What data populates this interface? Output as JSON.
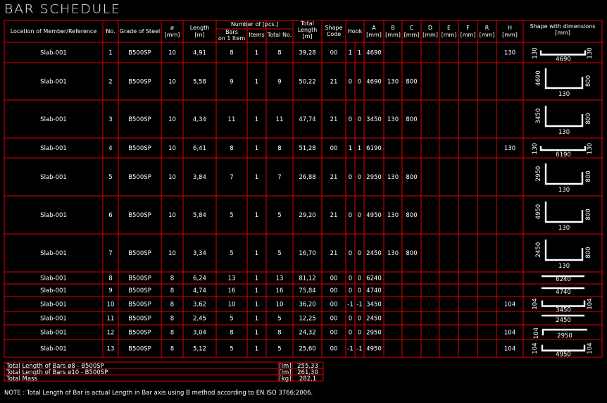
{
  "title": "BAR SCHEDULE",
  "headers": {
    "location": "Location of Member/Reference",
    "no": "No.",
    "grade": "Grade of Steel",
    "phi": "ø",
    "phi_unit": "[mm]",
    "length": "Length",
    "length_unit": "[m]",
    "number_of": "Number of [pcs.]",
    "bars_on": "Bars",
    "bars_on2": "on 1 Item",
    "items": "Items",
    "total_no": "Total No.",
    "total_length": "Total",
    "total_length2": "Length",
    "total_length_unit": "[m]",
    "shape": "Shape",
    "shape2": "Code",
    "hook": "Hook",
    "A": "A",
    "B": "B",
    "C": "C",
    "D": "D",
    "E": "E",
    "F": "F",
    "R": "R",
    "H": "H",
    "mm": "[mm]",
    "shape_dims": "Shape with dimensions",
    "shape_dims_unit": "[mm]"
  },
  "rows": [
    {
      "loc": "Slab-001",
      "no": "1",
      "grade": "B500SP",
      "phi": "10",
      "len": "4,91",
      "bars": "8",
      "items": "1",
      "total": "8",
      "tlen": "39,28",
      "code": "00",
      "h1": "1",
      "h2": "1",
      "A": "4690",
      "B": "",
      "C": "",
      "H": "130",
      "shape": "UL",
      "dims": [
        "130",
        "4690",
        "130"
      ]
    },
    {
      "loc": "Slab-001",
      "no": "2",
      "grade": "B500SP",
      "phi": "10",
      "len": "5,58",
      "bars": "9",
      "items": "1",
      "total": "9",
      "tlen": "50,22",
      "code": "21",
      "h1": "0",
      "h2": "0",
      "A": "4690",
      "B": "130",
      "C": "800",
      "H": "",
      "shape": "U",
      "dims": [
        "4690",
        "130",
        "800"
      ]
    },
    {
      "loc": "Slab-001",
      "no": "3",
      "grade": "B500SP",
      "phi": "10",
      "len": "4,34",
      "bars": "11",
      "items": "1",
      "total": "11",
      "tlen": "47,74",
      "code": "21",
      "h1": "0",
      "h2": "0",
      "A": "3450",
      "B": "130",
      "C": "800",
      "H": "",
      "shape": "U",
      "dims": [
        "3450",
        "130",
        "800"
      ]
    },
    {
      "loc": "Slab-001",
      "no": "4",
      "grade": "B500SP",
      "phi": "10",
      "len": "6,41",
      "bars": "8",
      "items": "1",
      "total": "8",
      "tlen": "51,28",
      "code": "00",
      "h1": "1",
      "h2": "1",
      "A": "6190",
      "B": "",
      "C": "",
      "H": "130",
      "shape": "UL",
      "dims": [
        "130",
        "6190",
        "130"
      ]
    },
    {
      "loc": "Slab-001",
      "no": "5",
      "grade": "B500SP",
      "phi": "10",
      "len": "3,84",
      "bars": "7",
      "items": "1",
      "total": "7",
      "tlen": "26,88",
      "code": "21",
      "h1": "0",
      "h2": "0",
      "A": "2950",
      "B": "130",
      "C": "800",
      "H": "",
      "shape": "U",
      "dims": [
        "2950",
        "130",
        "800"
      ]
    },
    {
      "loc": "Slab-001",
      "no": "6",
      "grade": "B500SP",
      "phi": "10",
      "len": "5,84",
      "bars": "5",
      "items": "1",
      "total": "5",
      "tlen": "29,20",
      "code": "21",
      "h1": "0",
      "h2": "0",
      "A": "4950",
      "B": "130",
      "C": "800",
      "H": "",
      "shape": "U",
      "dims": [
        "4950",
        "130",
        "800"
      ]
    },
    {
      "loc": "Slab-001",
      "no": "7",
      "grade": "B500SP",
      "phi": "10",
      "len": "3,34",
      "bars": "5",
      "items": "1",
      "total": "5",
      "tlen": "16,70",
      "code": "21",
      "h1": "0",
      "h2": "0",
      "A": "2450",
      "B": "130",
      "C": "800",
      "H": "",
      "shape": "U",
      "dims": [
        "2450",
        "130",
        "800"
      ]
    },
    {
      "loc": "Slab-001",
      "no": "8",
      "grade": "B500SP",
      "phi": "8",
      "len": "6,24",
      "bars": "13",
      "items": "1",
      "total": "13",
      "tlen": "81,12",
      "code": "00",
      "h1": "0",
      "h2": "0",
      "A": "6240",
      "B": "",
      "C": "",
      "H": "",
      "shape": "S",
      "dims": [
        "6240"
      ]
    },
    {
      "loc": "Slab-001",
      "no": "9",
      "grade": "B500SP",
      "phi": "8",
      "len": "4,74",
      "bars": "16",
      "items": "1",
      "total": "16",
      "tlen": "75,84",
      "code": "00",
      "h1": "0",
      "h2": "0",
      "A": "4740",
      "B": "",
      "C": "",
      "H": "",
      "shape": "S",
      "dims": [
        "4740"
      ]
    },
    {
      "loc": "Slab-001",
      "no": "10",
      "grade": "B500SP",
      "phi": "8",
      "len": "3,62",
      "bars": "10",
      "items": "1",
      "total": "10",
      "tlen": "36,20",
      "code": "00",
      "h1": "-1",
      "h2": "-1",
      "A": "3450",
      "B": "",
      "C": "",
      "H": "104",
      "shape": "HH",
      "dims": [
        "104",
        "3450",
        "104"
      ]
    },
    {
      "loc": "Slab-001",
      "no": "11",
      "grade": "B500SP",
      "phi": "8",
      "len": "2,45",
      "bars": "5",
      "items": "1",
      "total": "5",
      "tlen": "12,25",
      "code": "00",
      "h1": "0",
      "h2": "0",
      "A": "2450",
      "B": "",
      "C": "",
      "H": "",
      "shape": "S",
      "dims": [
        "2450"
      ]
    },
    {
      "loc": "Slab-001",
      "no": "12",
      "grade": "B500SP",
      "phi": "8",
      "len": "3,04",
      "bars": "8",
      "items": "1",
      "total": "8",
      "tlen": "24,32",
      "code": "00",
      "h1": "0",
      "h2": "0",
      "A": "2950",
      "B": "",
      "C": "",
      "H": "104",
      "shape": "L",
      "dims": [
        "104",
        "2950"
      ]
    },
    {
      "loc": "Slab-001",
      "no": "13",
      "grade": "B500SP",
      "phi": "8",
      "len": "5,12",
      "bars": "5",
      "items": "1",
      "total": "5",
      "tlen": "25,60",
      "code": "00",
      "h1": "-1",
      "h2": "-1",
      "A": "4950",
      "B": "",
      "C": "",
      "H": "104",
      "shape": "HH",
      "dims": [
        "104",
        "4950",
        "104"
      ]
    }
  ],
  "summary": [
    {
      "label": "Total Length of Bars ø8 - B500SP",
      "unit": "[lm]",
      "value": "255,33"
    },
    {
      "label": "Total Length of Bars ø10 - B500SP",
      "unit": "[lm]",
      "value": "261,30"
    },
    {
      "label": "Total Mass",
      "unit": "[kg]",
      "value": "282,1"
    }
  ],
  "note": "NOTE : Total Length of Bar is actual Length in Bar axis using B method according to EN ISO 3766:2006."
}
